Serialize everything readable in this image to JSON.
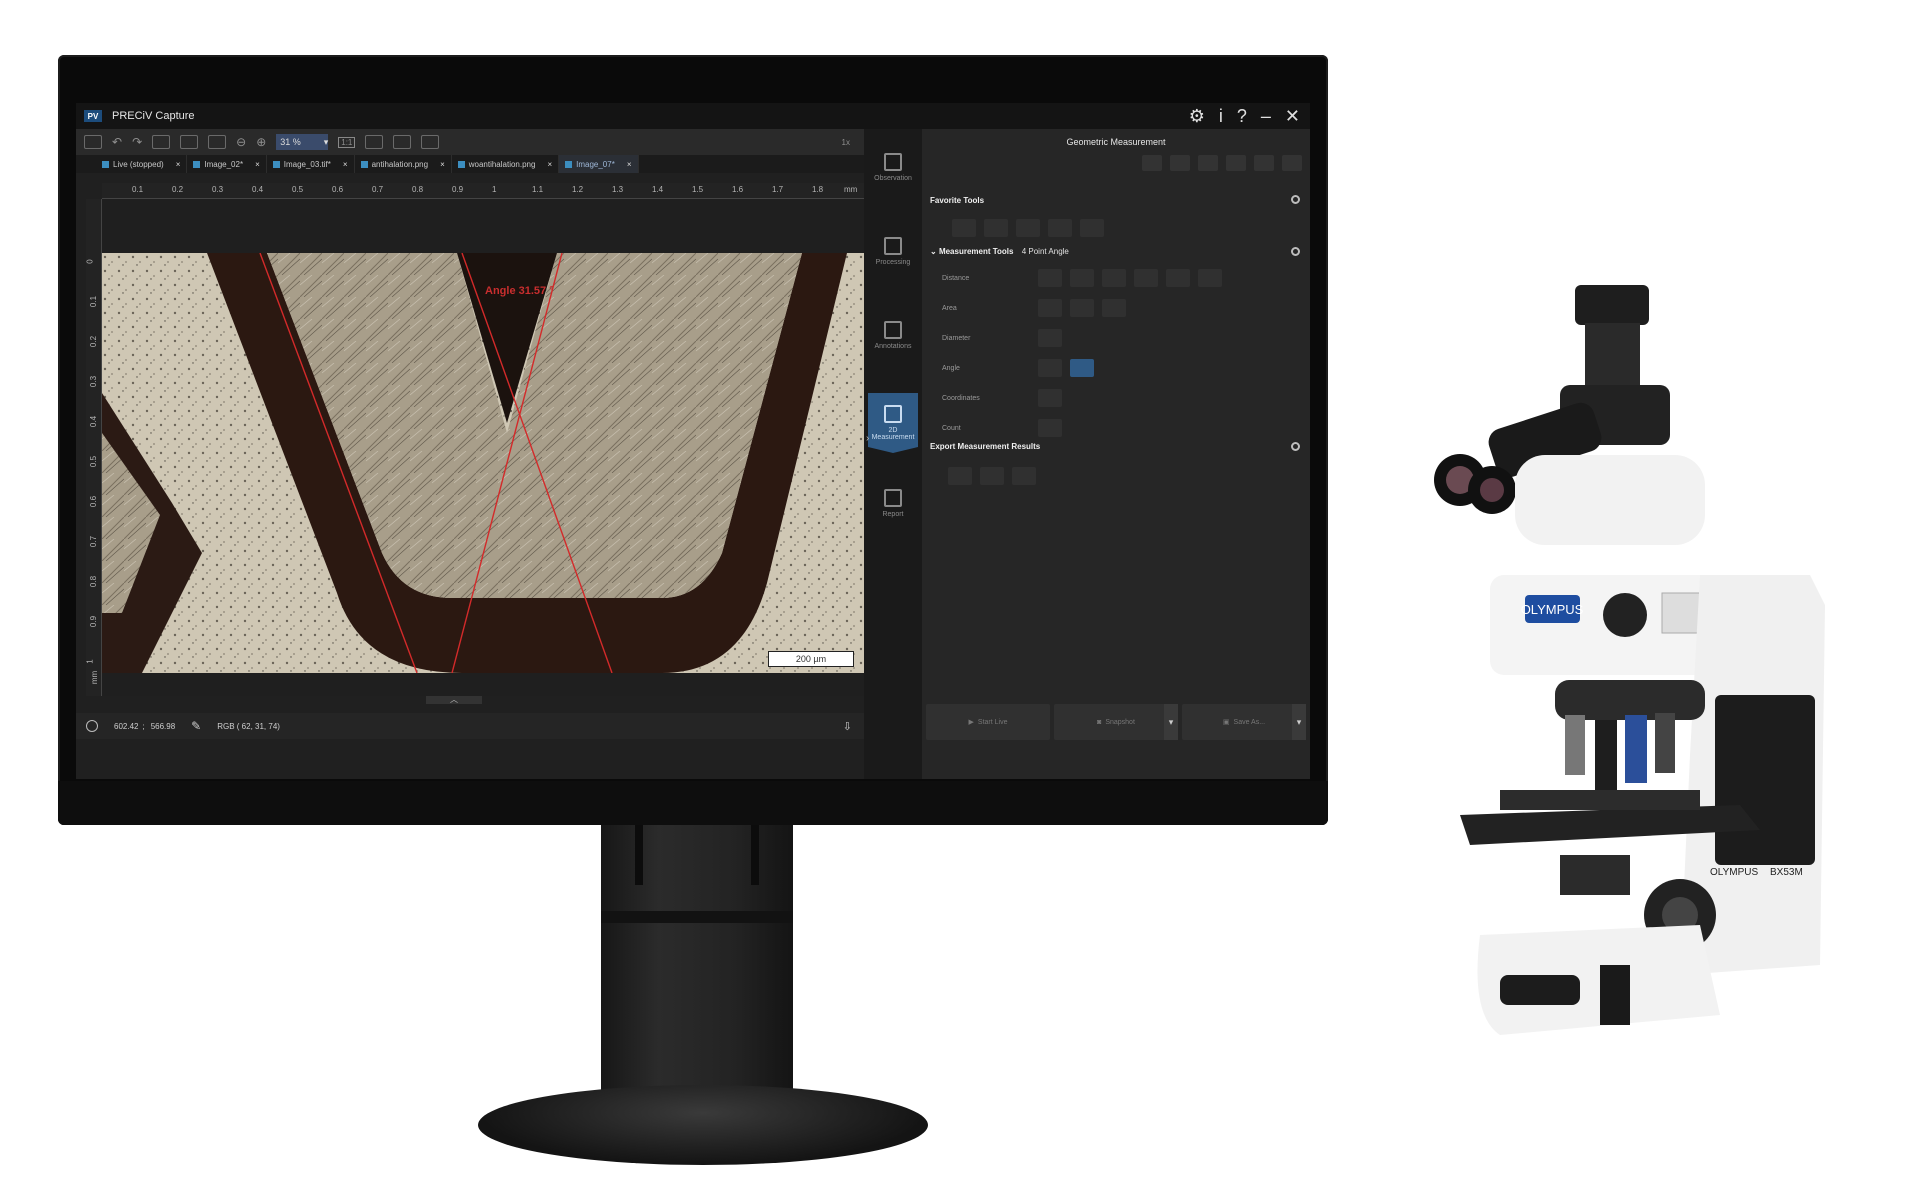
{
  "app": {
    "logo": "PV",
    "title": "PRECiV Capture",
    "window_controls": [
      "gear-icon",
      "info-icon",
      "help-icon",
      "minimize-icon",
      "close-icon"
    ]
  },
  "toolbar": {
    "zoom_value": "31 %",
    "one_to_one_label": "1:1",
    "counter_label": "1x"
  },
  "tabs": [
    {
      "label": "Live (stopped)",
      "active": false
    },
    {
      "label": "Image_02*",
      "active": false
    },
    {
      "label": "Image_03.tif*",
      "active": false
    },
    {
      "label": "antihalation.png",
      "active": false
    },
    {
      "label": "woantihalation.png",
      "active": false
    },
    {
      "label": "Image_07*",
      "active": true
    }
  ],
  "ruler": {
    "top_ticks": [
      "0.1",
      "0.2",
      "0.3",
      "0.4",
      "0.5",
      "0.6",
      "0.7",
      "0.8",
      "0.9",
      "1",
      "1.1",
      "1.2",
      "1.3",
      "1.4",
      "1.5",
      "1.6",
      "1.7",
      "1.8"
    ],
    "top_unit": "mm",
    "left_ticks": [
      "0",
      "0.1",
      "0.2",
      "0.3",
      "0.4",
      "0.5",
      "0.6",
      "0.7",
      "0.8",
      "0.9",
      "1"
    ],
    "left_unit": "mm"
  },
  "image": {
    "angle_label": "Angle 31.57 °",
    "scale_bar": "200 µm"
  },
  "statusbar": {
    "coords_x": "602.42",
    "coords_sep": ";",
    "coords_y": "566.98",
    "rgb": "RGB ( 62, 31, 74)"
  },
  "nav": [
    {
      "label": "Observation",
      "active": false
    },
    {
      "label": "Processing",
      "active": false
    },
    {
      "label": "Annotations",
      "active": false
    },
    {
      "label": "2D Measurement",
      "active": true
    },
    {
      "label": "Report",
      "active": false
    }
  ],
  "panel": {
    "title": "Geometric Measurement",
    "favorite_tools": "Favorite Tools",
    "measurement_tools": "Measurement Tools",
    "current_tool": "4 Point Angle",
    "rows": [
      {
        "label": "Distance",
        "count": 6,
        "selected": -1
      },
      {
        "label": "Area",
        "count": 3,
        "selected": -1
      },
      {
        "label": "Diameter",
        "count": 1,
        "selected": -1
      },
      {
        "label": "Angle",
        "count": 2,
        "selected": 1
      },
      {
        "label": "Coordinates",
        "count": 1,
        "selected": -1
      },
      {
        "label": "Count",
        "count": 1,
        "selected": -1
      }
    ],
    "export_results": "Export Measurement Results",
    "start_live": "Start Live",
    "snapshot": "Snapshot",
    "save_as": "Save As..."
  },
  "microscope": {
    "brand": "OLYMPUS",
    "model": "BX53M"
  },
  "colors": {
    "accent": "#2f5a85",
    "measure_line": "#d32a2a",
    "ui_dark": "#262626"
  }
}
